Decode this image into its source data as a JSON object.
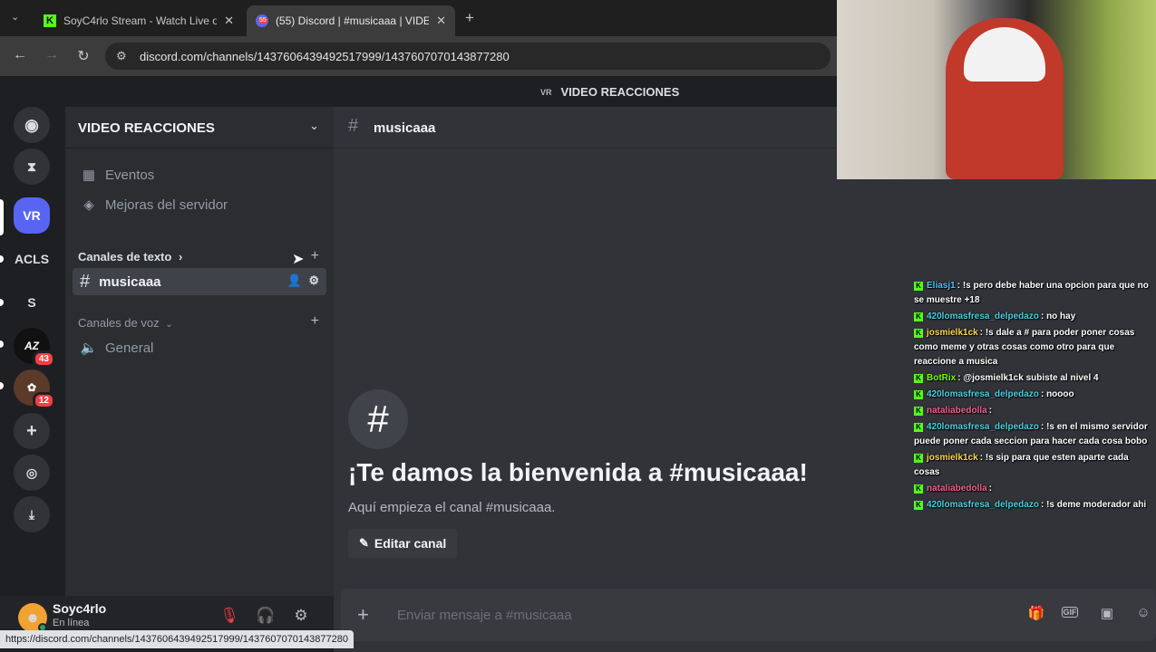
{
  "browser": {
    "tabs": [
      {
        "title": "SoyC4rlo Stream - Watch Live o",
        "favicon": "kick-icon"
      },
      {
        "title": "(55) Discord | #musicaaa | VIDE",
        "favicon": "discord-icon",
        "badge": "55"
      }
    ],
    "url": "discord.com/channels/1437606439492517999/1437607070143877280",
    "status_url": "https://discord.com/channels/1437606439492517999/1437607070143877280"
  },
  "discord": {
    "title_bar": {
      "server_abbr": "VR",
      "server_name": "VIDEO REACCIONES"
    },
    "rail": {
      "servers": [
        {
          "label": "VR",
          "active": true
        },
        {
          "label": "ACLS"
        },
        {
          "label": "S"
        },
        {
          "label": "",
          "badge": "43"
        },
        {
          "label": "",
          "badge": "12"
        }
      ]
    },
    "sidebar": {
      "server_name": "VIDEO REACCIONES",
      "events": "Eventos",
      "boosts": "Mejoras del servidor",
      "text_category": "Canales de texto",
      "text_channel": "musicaaa",
      "voice_category": "Canales de voz",
      "voice_channel": "General"
    },
    "user": {
      "name": "Soyc4rlo",
      "status": "En línea"
    },
    "main": {
      "channel": "musicaaa",
      "welcome_title": "¡Te damos la bienvenida a #musicaaa!",
      "welcome_sub": "Aquí empieza el canal #musicaaa.",
      "edit_button": "Editar canal",
      "composer_placeholder": "Enviar mensaje a #musicaaa"
    }
  },
  "chat": {
    "messages": [
      {
        "user": "Eliasj1",
        "color": "#4fc3f7",
        "text": "!s pero debe haber una opcion para que no se muestre +18"
      },
      {
        "user": "420lomasfresa_delpedazo",
        "color": "#4dd0e1",
        "text": "no hay"
      },
      {
        "user": "josmielk1ck",
        "color": "#ffd54f",
        "text": "!s dale a # para poder poner cosas como meme y otras cosas como otro para que reaccione a musica"
      },
      {
        "user": "BotRix",
        "color": "#76ff03",
        "text": "@josmielk1ck subiste al nivel 4"
      },
      {
        "user": "420lomasfresa_delpedazo",
        "color": "#4dd0e1",
        "text": "noooo"
      },
      {
        "user": "nataliabedolla",
        "color": "#f06292",
        "text": ""
      },
      {
        "user": "420lomasfresa_delpedazo",
        "color": "#4dd0e1",
        "text": "!s en el mismo servidor puede poner cada seccion para hacer cada cosa bobo"
      },
      {
        "user": "josmielk1ck",
        "color": "#ffd54f",
        "text": "!s sip para que esten aparte cada cosas"
      },
      {
        "user": "nataliabedolla",
        "color": "#f06292",
        "text": ""
      },
      {
        "user": "420lomasfresa_delpedazo",
        "color": "#4dd0e1",
        "text": "!s deme moderador ahi"
      }
    ]
  }
}
